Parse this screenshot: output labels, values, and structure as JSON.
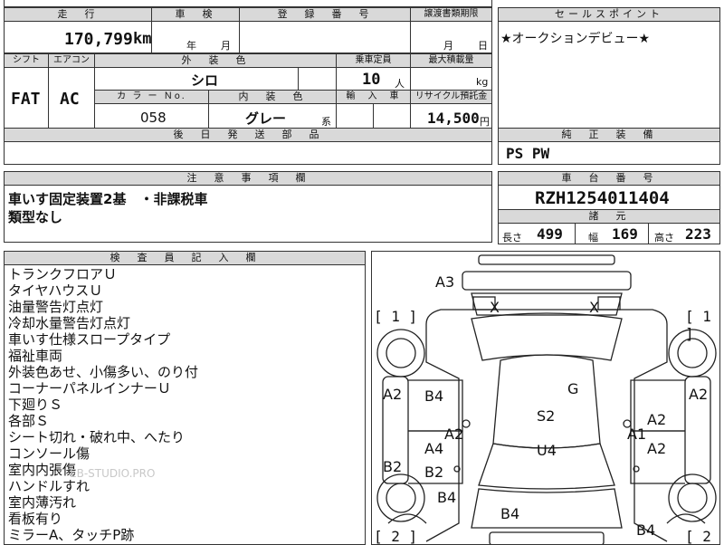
{
  "top": {
    "mileage_header": "走　行",
    "mileage_value": "170,799",
    "mileage_unit": "km",
    "inspection_header": "車　検",
    "inspection_year": "年",
    "inspection_month": "月",
    "registration_header": "登　録　番　号",
    "transfer_header": "譲渡書類期限",
    "transfer_month": "月",
    "transfer_day": "日"
  },
  "row2": {
    "shift_header": "シフト",
    "ac_header": "エアコン",
    "exterior_header": "外　装　色",
    "capacity_header": "乗車定員",
    "maxload_header": "最大積載量",
    "shift_value": "FAT",
    "ac_value": "AC",
    "exterior_value": "シロ",
    "capacity_value": "10",
    "capacity_unit": "人",
    "maxload_unit": "kg",
    "colorno_header": "カ ラ ー Ｎo.",
    "interior_header": "内　装　色",
    "import_header": "輸　入　車",
    "recycle_header": "リサイクル預託金",
    "colorno_value": "058",
    "interior_value": "グレー",
    "interior_suffix": "系",
    "recycle_value": "14,500",
    "recycle_unit": "円",
    "later_parts_header": "後　日　発　送　部　品"
  },
  "sales": {
    "header": "セールスポイント",
    "text": "★オークションデビュー★"
  },
  "equipment": {
    "header": "純　正　装　備",
    "text": "PS PW"
  },
  "notes": {
    "header": "注　意　事　項　欄",
    "line1": "車いす固定装置2基　・非課税車",
    "line2": "類型なし"
  },
  "chassis": {
    "header": "車　台　番　号",
    "value": "RZH1254011404"
  },
  "specs": {
    "header": "諸　元",
    "length_label": "長さ",
    "length_value": "499",
    "width_label": "幅",
    "width_value": "169",
    "height_label": "高さ",
    "height_value": "223"
  },
  "inspector": {
    "header": "検　査　員　記　入　欄",
    "lines": [
      "トランクフロアＵ",
      "タイヤハウスＵ",
      "油量警告灯点灯",
      "冷却水量警告灯点灯",
      "車いす仕様スロープタイプ",
      "福祉車両",
      "外装色あせ、小傷多い、のり付",
      "コーナーパネルインナーＵ",
      "下廻りＳ",
      "各部Ｓ",
      "シート切れ・破れ中、へたり",
      "コンソール傷",
      "室内内張傷",
      "ハンドルすれ",
      "室内薄汚れ",
      "看板有り",
      "ミラーA、タッチP跡"
    ]
  },
  "diagram": {
    "labels": [
      "A3",
      "X",
      "X",
      "A2",
      "A2",
      "B4",
      "G",
      "S2",
      "A2",
      "A1",
      "A2",
      "A4",
      "U4",
      "A2",
      "B2",
      "B2",
      "B4",
      "B4",
      "B4"
    ],
    "bracket_1_left": "[ 1 ]",
    "bracket_1_right": "[ 1 ]",
    "bracket_2_left": "[ 2 ]",
    "bracket_2_right": "[ 2 ]"
  },
  "watermark": "EB-STUDIO.PRO"
}
